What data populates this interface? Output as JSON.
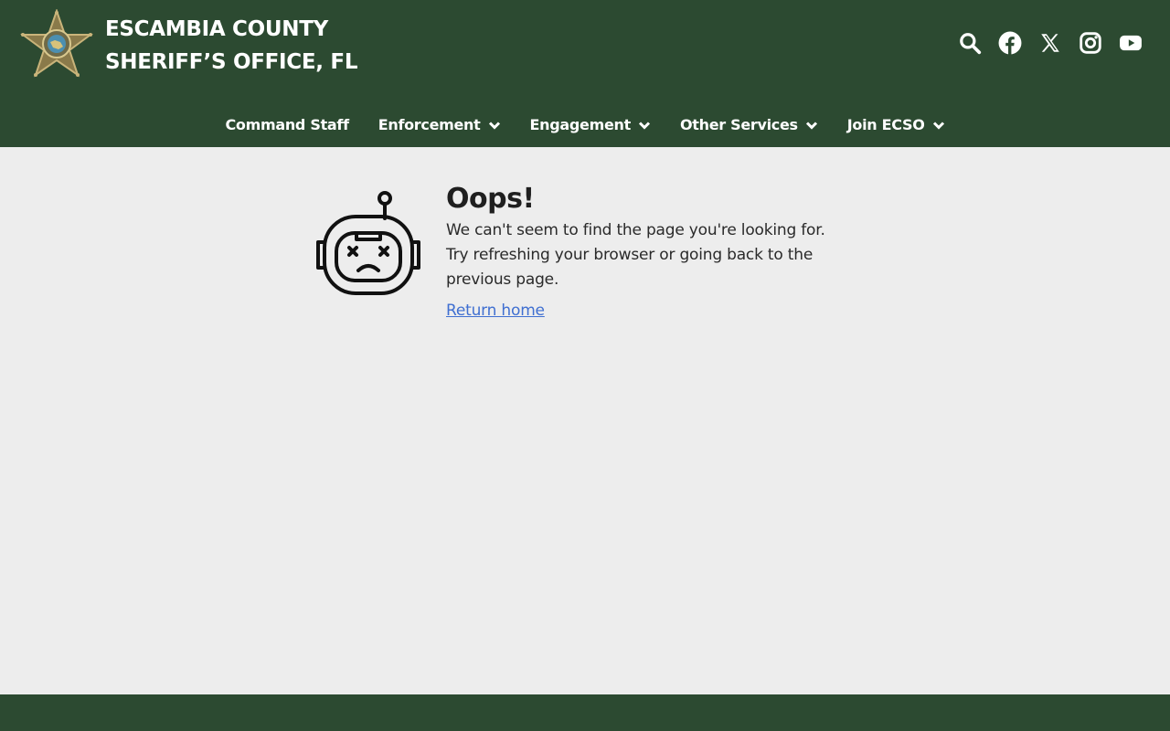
{
  "header": {
    "brand_line1": "ESCAMBIA COUNTY",
    "brand_line2": "SHERIFF’S OFFICE, FL",
    "logo_icon": "sheriff-star-badge",
    "bg_color": "#2c4a31",
    "social_icons": [
      "search-icon",
      "facebook-icon",
      "x-icon",
      "instagram-icon",
      "youtube-icon"
    ]
  },
  "nav": {
    "items": [
      {
        "label": "Command Staff",
        "has_dropdown": false
      },
      {
        "label": "Enforcement",
        "has_dropdown": true
      },
      {
        "label": "Engagement",
        "has_dropdown": true
      },
      {
        "label": "Other Services",
        "has_dropdown": true
      },
      {
        "label": "Join ECSO",
        "has_dropdown": true
      }
    ]
  },
  "error": {
    "icon": "sad-robot-icon",
    "title": "Oops!",
    "message_line1": "We can't seem to find the page you're looking for.",
    "message_line2": "Try refreshing your browser or going back to the",
    "message_line3": "previous page.",
    "link_label": "Return home",
    "link_color": "#3f6fd1"
  },
  "footer": {
    "bg_color": "#2c4a31"
  }
}
